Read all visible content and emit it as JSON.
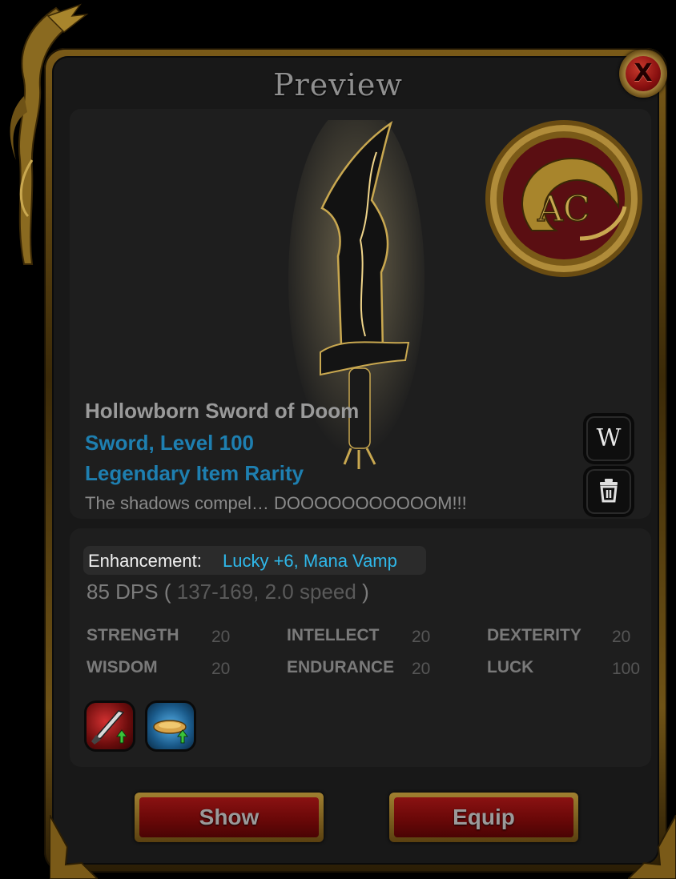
{
  "window": {
    "title": "Preview",
    "close_label": "X"
  },
  "item": {
    "name": "Hollowborn Sword of Doom",
    "type_level": "Sword, Level 100",
    "rarity": "Legendary Item Rarity",
    "description": "The shadows compel… DOOOOOOOOOOOM!!!",
    "badge_text": "AC"
  },
  "side_buttons": {
    "wiki_label": "W"
  },
  "enhancement": {
    "label": "Enhancement:",
    "value": "Lucky +6, Mana Vamp"
  },
  "damage": {
    "dps": "85 DPS",
    "open": "(",
    "range": "137-169, 2.0 speed",
    "close": ")"
  },
  "stats": [
    {
      "name": "STRENGTH",
      "value": "20"
    },
    {
      "name": "INTELLECT",
      "value": "20"
    },
    {
      "name": "DEXTERITY",
      "value": "20"
    },
    {
      "name": "WISDOM",
      "value": "20"
    },
    {
      "name": "ENDURANCE",
      "value": "20"
    },
    {
      "name": "LUCK",
      "value": "100"
    }
  ],
  "skills": [
    {
      "icon": "weapon-buff-icon"
    },
    {
      "icon": "armor-buff-icon"
    }
  ],
  "buttons": {
    "show": "Show",
    "equip": "Equip"
  },
  "colors": {
    "accent_blue": "#1e7fb0",
    "enhancement_blue": "#2fb8ea",
    "button_red": "#7a0c0c",
    "gold": "#8a6a20"
  }
}
